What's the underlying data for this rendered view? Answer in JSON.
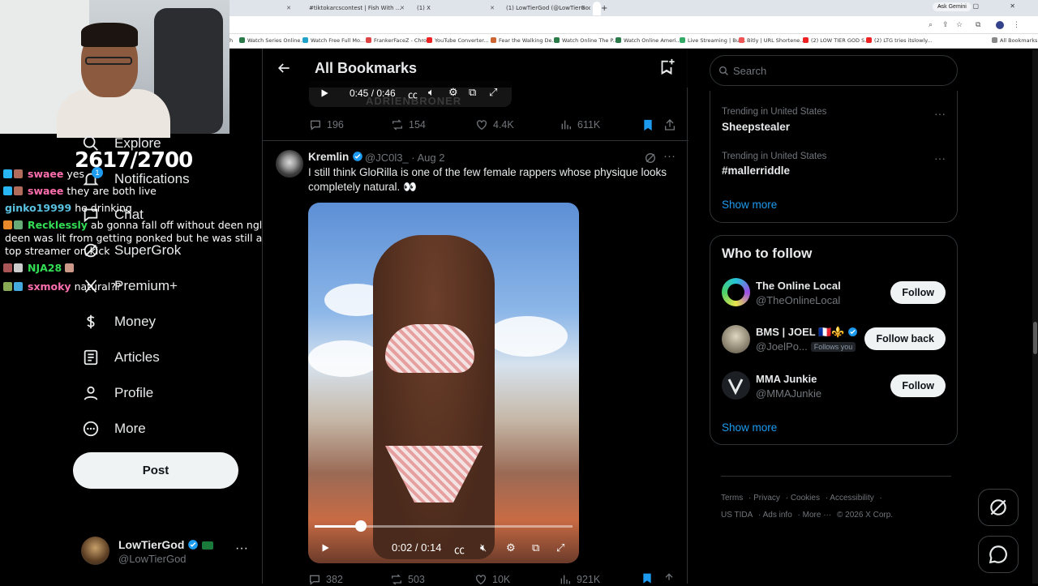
{
  "browser": {
    "tabs": [
      {
        "label": "#tiktokarcscontest | Fish With ...",
        "active": false
      },
      {
        "label": "(1) X",
        "active": false
      },
      {
        "label": "(1) LowTierGod (@LowTierGod...",
        "active": false
      },
      {
        "label": "LowTierGod (@LowTierGod...",
        "active": true
      }
    ],
    "ask_gemini": "Ask Gemini",
    "bookmarks": [
      "Watch Series Online...",
      "Watch Free Full Mo...",
      "FrankerFaceZ - Chro...",
      "YouTube Converter...",
      "Fear the Walking De...",
      "Watch Online The P...",
      "Watch Online Ameri...",
      "Live Streaming | Bul...",
      "Bitly | URL Shortene...",
      "(2) LOW TIER GOD S...",
      "(2) LTG tries itslowly...",
      "All Bookmarks"
    ]
  },
  "stream": {
    "score": "2617/2700",
    "chat": [
      {
        "user": "swaee",
        "text": "yes",
        "color": "#ff6fae"
      },
      {
        "user": "swaee",
        "text": "they are both live",
        "color": "#ff6fae"
      },
      {
        "user": "ginko19999",
        "text": "he drinking",
        "color": "#59c1e0"
      },
      {
        "user": "Recklessly",
        "text": "ab gonna fall off without deen ngl",
        "color": "#33dd55"
      },
      {
        "user": "",
        "text": "deen was lit from getting ponked but he was still a",
        "color": "#ffffff"
      },
      {
        "user": "",
        "text": "top streamer on kick",
        "color": "#ffffff"
      },
      {
        "user": "NJA28",
        "text": "",
        "color": "#33dd55"
      },
      {
        "user": "sxmoky",
        "text": "natural??",
        "color": "#ff6fae"
      }
    ]
  },
  "nav": {
    "items": [
      {
        "label": "Explore",
        "icon": "search-icon"
      },
      {
        "label": "Notifications",
        "icon": "bell-icon",
        "badge": "1"
      },
      {
        "label": "Chat",
        "icon": "chat-icon"
      },
      {
        "label": "SuperGrok",
        "icon": "grok-icon"
      },
      {
        "label": "Premium+",
        "icon": "x-logo-icon"
      },
      {
        "label": "Money",
        "icon": "money-icon"
      },
      {
        "label": "Articles",
        "icon": "articles-icon"
      },
      {
        "label": "Profile",
        "icon": "person-icon"
      },
      {
        "label": "More",
        "icon": "more-circle-icon"
      }
    ],
    "post_label": "Post",
    "account": {
      "name": "LowTierGod",
      "handle": "@LowTierGod"
    }
  },
  "main": {
    "title": "All Bookmarks",
    "prev_tweet": {
      "video_time": "0:45 / 0:46",
      "watermark": "ADRIENBRONER",
      "replies": "196",
      "reposts": "154",
      "likes": "4.4K",
      "views": "611K"
    },
    "tweet": {
      "name": "Kremlin",
      "handle": "@JC0l3_",
      "date": "Aug 2",
      "text": "I still think GloRilla is one of the few female rappers whose physique looks completely natural. 👀",
      "video_time": "0:02 / 0:14",
      "progress": 0.18,
      "replies": "382",
      "reposts": "503",
      "likes": "10K",
      "views": "921K"
    }
  },
  "sidebar": {
    "search_placeholder": "Search",
    "trends": [
      {
        "context": "Trending in United States",
        "tag": "Sheepstealer"
      },
      {
        "context": "Trending in United States",
        "tag": "#mallerriddle"
      }
    ],
    "trends_show_more": "Show more",
    "who_to_follow_title": "Who to follow",
    "follow": [
      {
        "name": "The Online Local",
        "handle": "@TheOnlineLocal",
        "button": "Follow"
      },
      {
        "name": "BMS | JOEL 🇫🇷⚜️",
        "handle": "@JoelPo...",
        "follows_you": "Follows you",
        "button": "Follow back"
      },
      {
        "name": "MMA Junkie",
        "handle": "@MMAJunkie",
        "button": "Follow"
      }
    ],
    "follow_show_more": "Show more",
    "footer": [
      "Terms",
      "Privacy",
      "Cookies",
      "Accessibility",
      "US TIDA",
      "Ads info",
      "More ···",
      "© 2026 X Corp."
    ]
  }
}
